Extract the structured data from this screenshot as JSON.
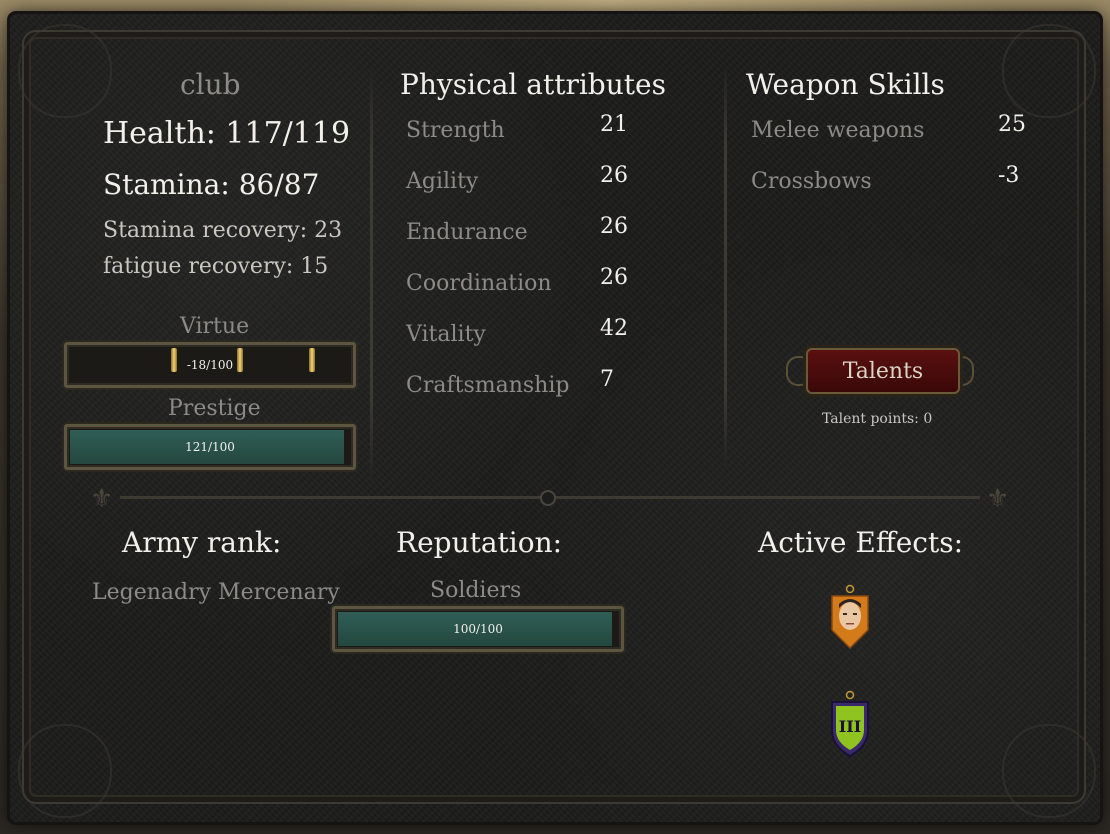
{
  "character": {
    "name": "club",
    "health": "Health: 117/119",
    "stamina": "Stamina: 86/87",
    "stamina_recovery": "Stamina recovery: 23",
    "fatigue_recovery": "fatigue recovery: 15"
  },
  "virtue": {
    "label": "Virtue",
    "value": "-18/100",
    "fill": 0
  },
  "prestige": {
    "label": "Prestige",
    "value": "121/100",
    "fill": 1.0
  },
  "physical": {
    "title": "Physical attributes",
    "rows": [
      {
        "label": "Strength",
        "value": "21"
      },
      {
        "label": "Agility",
        "value": "26"
      },
      {
        "label": "Endurance",
        "value": "26"
      },
      {
        "label": "Coordination",
        "value": "26"
      },
      {
        "label": "Vitality",
        "value": "42"
      },
      {
        "label": "Craftsmanship",
        "value": "7"
      }
    ]
  },
  "weapons": {
    "title": "Weapon Skills",
    "rows": [
      {
        "label": "Melee weapons",
        "value": "25"
      },
      {
        "label": "Crossbows",
        "value": "-3"
      }
    ]
  },
  "talents": {
    "button_label": "Talents",
    "points": "Talent points: 0"
  },
  "army": {
    "title": "Army rank:",
    "rank": "Legenadry Mercenary"
  },
  "reputation": {
    "title": "Reputation:",
    "faction": "Soldiers",
    "value": "100/100",
    "fill": 1.0
  },
  "effects": {
    "title": "Active Effects:",
    "items": [
      {
        "icon": "portrait-effect-icon"
      },
      {
        "icon": "roman-three-shield-icon",
        "label": "III"
      }
    ]
  },
  "colors": {
    "bar_fill": "#2f5e56",
    "button_red": "#5a1010",
    "frame_gold": "#5c5540",
    "shield_green": "#8fc31f"
  }
}
